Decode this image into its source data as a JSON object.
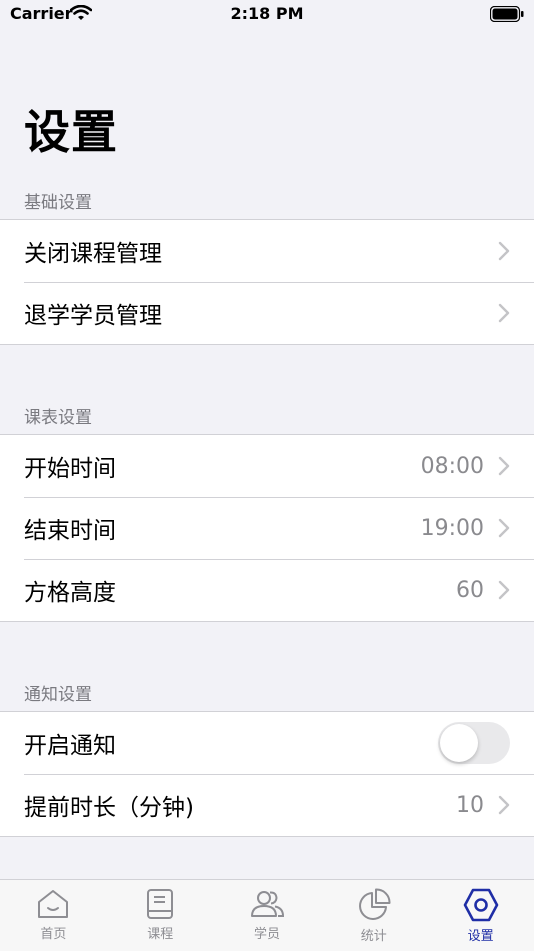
{
  "status_bar": {
    "carrier": "Carrier",
    "time": "2:18 PM"
  },
  "page": {
    "title": "设置"
  },
  "sections": {
    "basic": {
      "header": "基础设置",
      "rows": [
        {
          "label": "关闭课程管理"
        },
        {
          "label": "退学学员管理"
        }
      ]
    },
    "schedule": {
      "header": "课表设置",
      "rows": [
        {
          "label": "开始时间",
          "value": "08:00"
        },
        {
          "label": "结束时间",
          "value": "19:00"
        },
        {
          "label": "方格高度",
          "value": "60"
        }
      ]
    },
    "notification": {
      "header": "通知设置",
      "rows": [
        {
          "label": "开启通知",
          "toggle_on": false
        },
        {
          "label": "提前时长（分钟)",
          "value": "10"
        }
      ]
    }
  },
  "tab_bar": {
    "active": "settings",
    "tabs": [
      {
        "label": "首页",
        "icon": "home-icon"
      },
      {
        "label": "课程",
        "icon": "book-icon"
      },
      {
        "label": "学员",
        "icon": "people-icon"
      },
      {
        "label": "统计",
        "icon": "pie-chart-icon"
      },
      {
        "label": "设置",
        "icon": "hexagon-settings-icon"
      }
    ]
  },
  "colors": {
    "background": "#f2f2f7",
    "active_tab": "#1f2ea6",
    "secondary_text": "#8a8a8e",
    "toggle_off": "#e9e9eb"
  }
}
